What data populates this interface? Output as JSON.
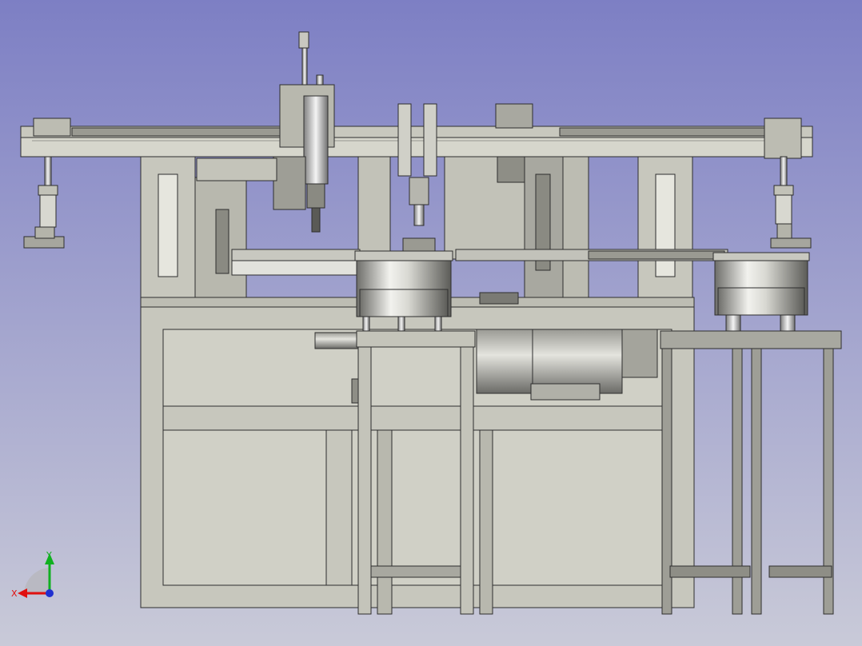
{
  "viewport": {
    "background_top": "#7d7fc4",
    "background_bottom": "#c9cad8"
  },
  "model": {
    "frame_color": "#c7c7bd",
    "frame_edge": "#2e2e2e",
    "metal_color": "#b4b4ae",
    "shadow_color": "#7e7e78"
  },
  "axis_triad": {
    "x_label": "X",
    "y_label": "Y",
    "x_color": "#e01010",
    "y_color": "#10b020",
    "z_color": "#2030d0"
  }
}
